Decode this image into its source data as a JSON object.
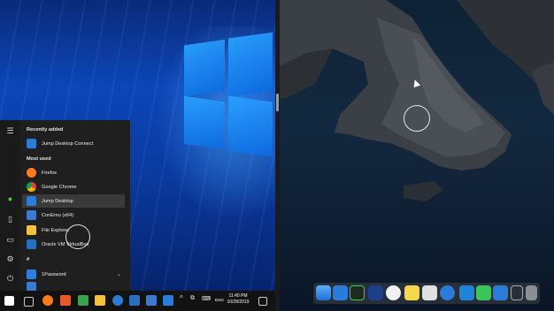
{
  "start_menu": {
    "recently_added_header": "Recently added",
    "most_used_header": "Most used",
    "section_hash": "#",
    "items": [
      {
        "label": "Jump Desktop Connect",
        "icon": "jump-desktop-connect-icon",
        "color": "#2b7bd8"
      },
      {
        "label": "Firefox",
        "icon": "firefox-icon",
        "color": "#ff7b1a"
      },
      {
        "label": "Google Chrome",
        "icon": "chrome-icon",
        "color": "#e0b21f"
      },
      {
        "label": "Jump Desktop",
        "icon": "jump-desktop-icon",
        "color": "#2b7bd8"
      },
      {
        "label": "ConEmu (x64)",
        "icon": "conemu-icon",
        "color": "#3a7bd0"
      },
      {
        "label": "File Explorer",
        "icon": "file-explorer-icon",
        "color": "#f3c23a"
      },
      {
        "label": "Oracle VM VirtualBox",
        "icon": "virtualbox-icon",
        "color": "#2a6fbf"
      },
      {
        "label": "1Password",
        "icon": "onepassword-icon",
        "color": "#2f7fe0"
      }
    ]
  },
  "taskbar": {
    "lang": "ENG",
    "time": "11:40 PM",
    "date": "10/28/2019"
  },
  "colors": {
    "start_bg": "#1f1f1f",
    "taskbar_bg": "#121212",
    "selected_item": "#3a3a3a"
  }
}
